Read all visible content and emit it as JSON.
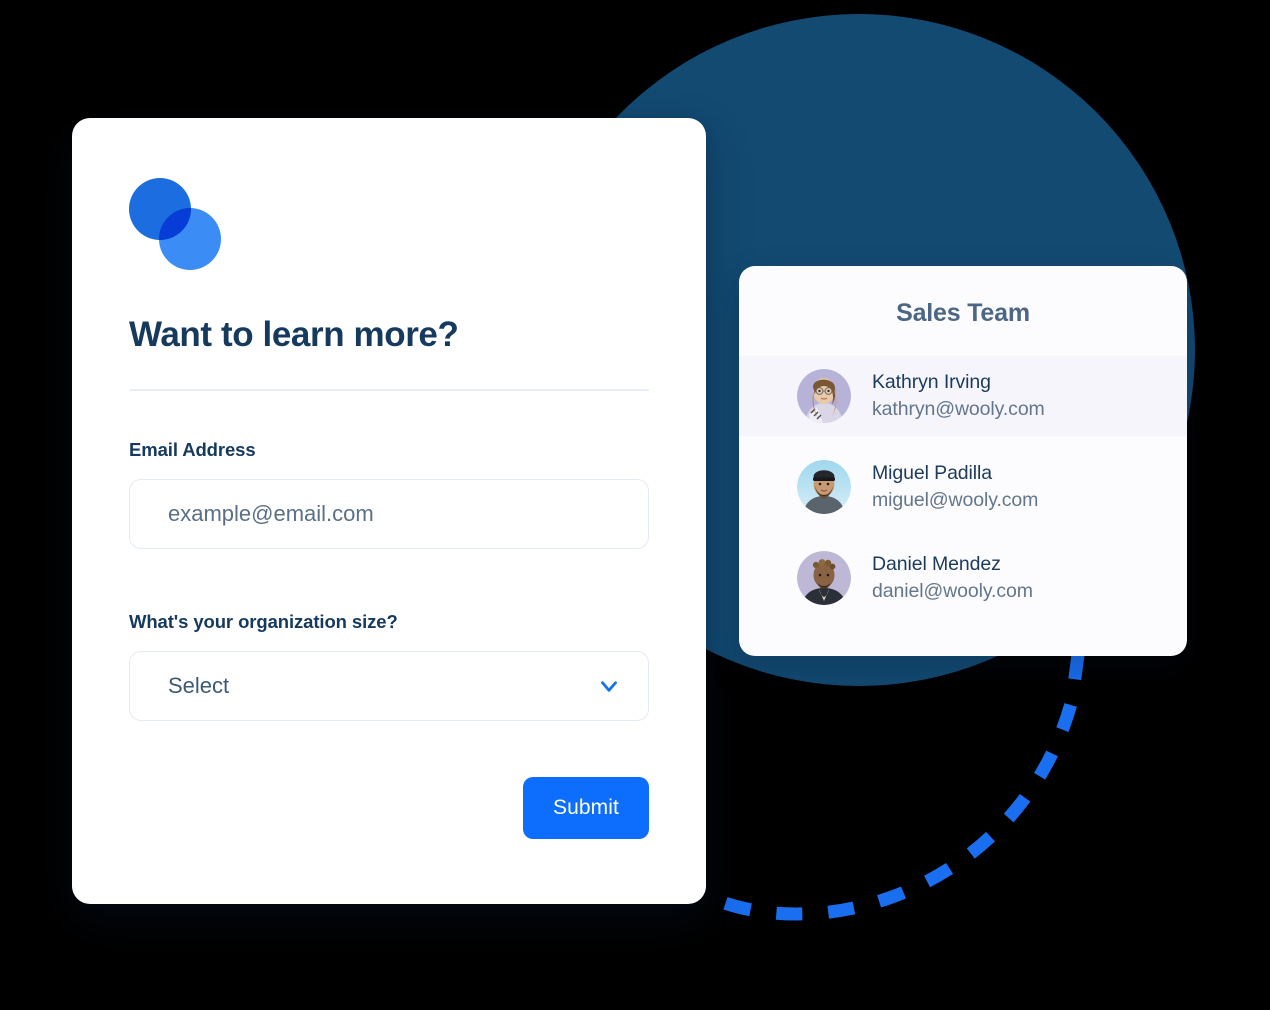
{
  "colors": {
    "accent_blue": "#0D6EFD",
    "logo_dark": "#1B6DE0",
    "logo_light": "#3B8DF5",
    "deep_navy_circle": "#134A72",
    "heading_navy": "#163A5E",
    "muted_text": "#5B7085",
    "team_title": "#4C6685",
    "row_highlight": "#F7F5FC",
    "divider": "#E7EDF7",
    "input_border": "#E4EAF4",
    "canvas": "#000000"
  },
  "form": {
    "logo_icon": "two-overlapping-circles-logo",
    "title": "Want to learn more?",
    "email": {
      "label": "Email Address",
      "placeholder": "example@email.com",
      "value": ""
    },
    "org_size": {
      "label": "What's your organization size?",
      "selected": "Select",
      "chevron_icon": "chevron-down-icon"
    },
    "submit_label": "Submit"
  },
  "team": {
    "title": "Sales Team",
    "members": [
      {
        "name": "Kathryn Irving",
        "email": "kathryn@wooly.com",
        "avatar_icon": "avatar-photo-woman-glasses",
        "highlighted": true
      },
      {
        "name": "Miguel Padilla",
        "email": "miguel@wooly.com",
        "avatar_icon": "avatar-photo-man-beanie",
        "highlighted": false
      },
      {
        "name": "Daniel Mendez",
        "email": "daniel@wooly.com",
        "avatar_icon": "avatar-photo-man-dreadlocks",
        "highlighted": false
      }
    ]
  },
  "decor": {
    "connector_icon": "dashed-curved-connector",
    "circle_icon": "large-navy-circle"
  }
}
